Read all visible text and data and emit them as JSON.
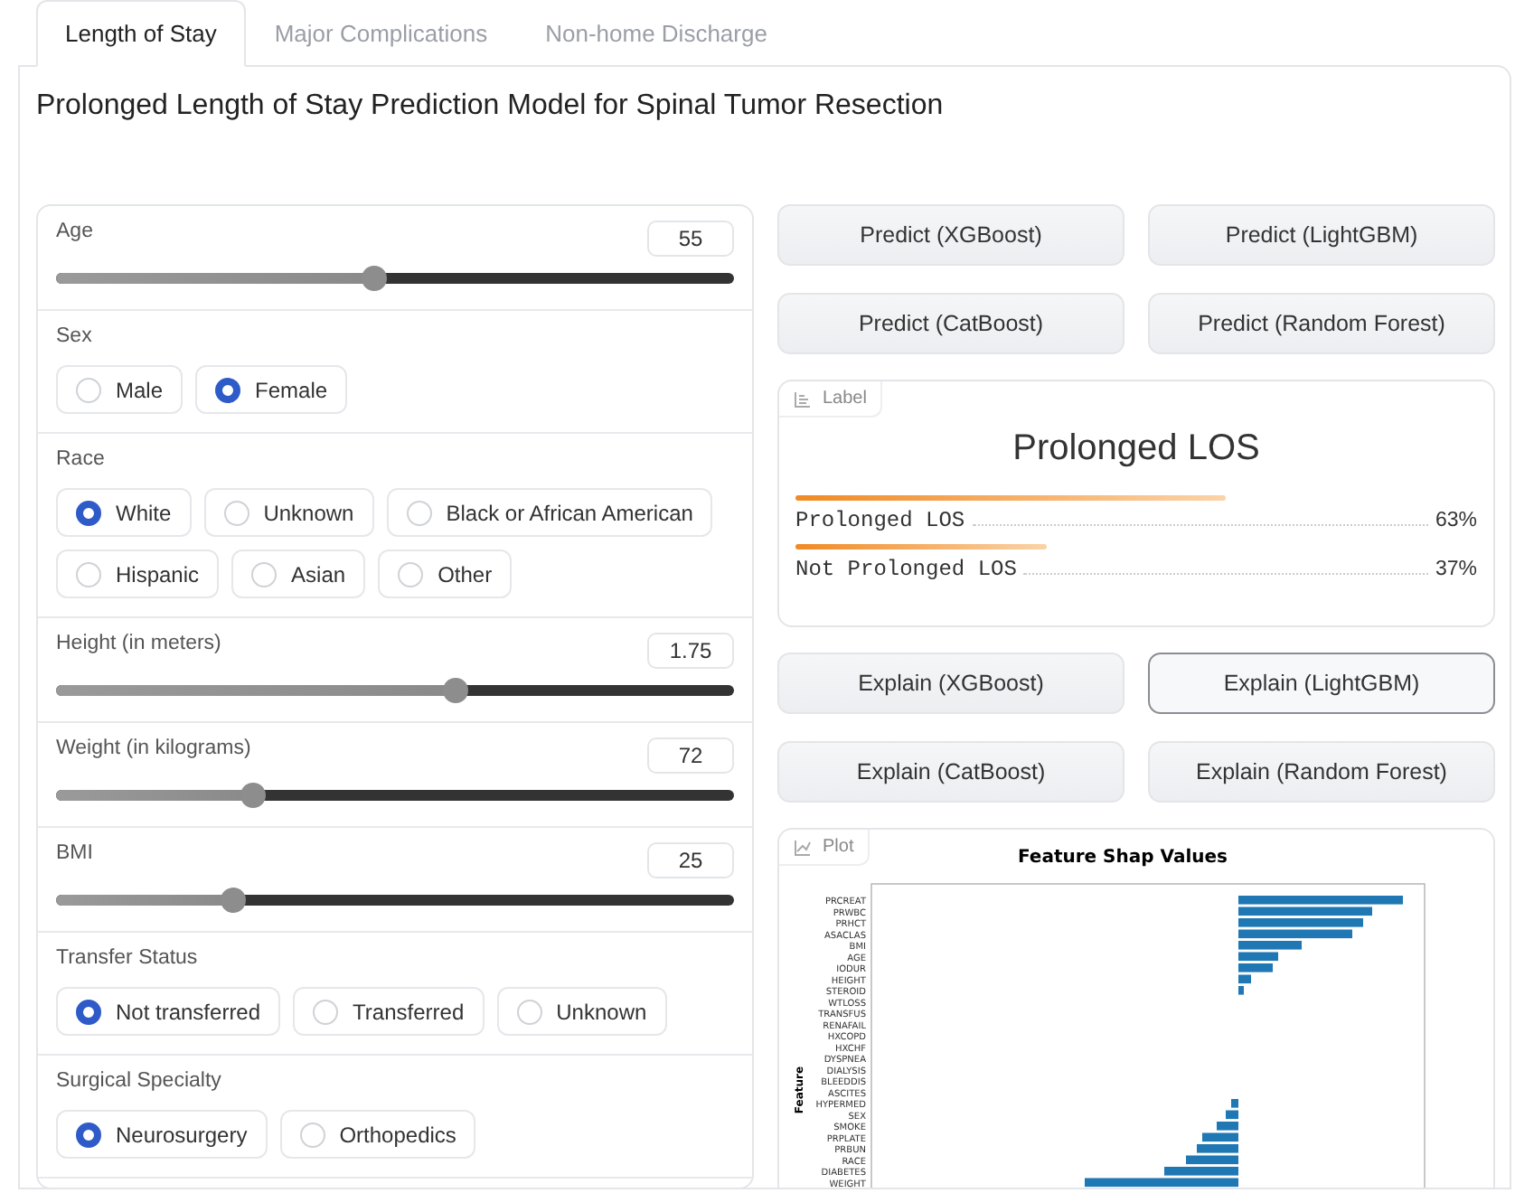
{
  "tabs": [
    {
      "label": "Length of Stay",
      "selected": true
    },
    {
      "label": "Major Complications",
      "selected": false
    },
    {
      "label": "Non-home Discharge",
      "selected": false
    }
  ],
  "title": "Prolonged Length of Stay Prediction Model for Spinal Tumor Resection",
  "inputs": [
    {
      "kind": "slider",
      "label": "Age",
      "value": "55",
      "level": 0.47
    },
    {
      "kind": "radio",
      "label": "Sex",
      "options": [
        {
          "label": "Male",
          "selected": false
        },
        {
          "label": "Female",
          "selected": true
        }
      ]
    },
    {
      "kind": "radio",
      "label": "Race",
      "options": [
        {
          "label": "White",
          "selected": true
        },
        {
          "label": "Unknown",
          "selected": false
        },
        {
          "label": "Black or African American",
          "selected": false
        },
        {
          "label": "Hispanic",
          "selected": false
        },
        {
          "label": "Asian",
          "selected": false
        },
        {
          "label": "Other",
          "selected": false
        }
      ]
    },
    {
      "kind": "slider",
      "label": "Height (in meters)",
      "value": "1.75",
      "level": 0.59
    },
    {
      "kind": "slider",
      "label": "Weight (in kilograms)",
      "value": "72",
      "level": 0.29
    },
    {
      "kind": "slider",
      "label": "BMI",
      "value": "25",
      "level": 0.26
    },
    {
      "kind": "radio",
      "label": "Transfer Status",
      "options": [
        {
          "label": "Not transferred",
          "selected": true
        },
        {
          "label": "Transferred",
          "selected": false
        },
        {
          "label": "Unknown",
          "selected": false
        }
      ]
    },
    {
      "kind": "radio",
      "label": "Surgical Specialty",
      "options": [
        {
          "label": "Neurosurgery",
          "selected": true
        },
        {
          "label": "Orthopedics",
          "selected": false
        }
      ]
    }
  ],
  "predict_buttons": [
    {
      "label": "Predict (XGBoost)",
      "focused": false
    },
    {
      "label": "Predict (LightGBM)",
      "focused": false
    },
    {
      "label": "Predict (CatBoost)",
      "focused": false
    },
    {
      "label": "Predict (Random Forest)",
      "focused": false
    }
  ],
  "label_output": {
    "header": "Label",
    "prediction": "Prolonged LOS",
    "confidences": [
      {
        "label": "Prolonged LOS",
        "percent": "63%"
      },
      {
        "label": "Not Prolonged LOS",
        "percent": "37%"
      }
    ]
  },
  "explain_buttons": [
    {
      "label": "Explain (XGBoost)",
      "focused": false
    },
    {
      "label": "Explain (LightGBM)",
      "focused": true
    },
    {
      "label": "Explain (CatBoost)",
      "focused": false
    },
    {
      "label": "Explain (Random Forest)",
      "focused": false
    }
  ],
  "plot": {
    "header": "Plot",
    "title": "Feature Shap Values",
    "ylabel": "Feature",
    "features": [
      "PRCREAT",
      "PRWBC",
      "PRHCT",
      "ASACLAS",
      "BMI",
      "AGE",
      "IODUR",
      "HEIGHT",
      "STEROID",
      "WTLOSS",
      "TRANSFUS",
      "RENAFAIL",
      "HXCOPD",
      "HXCHF",
      "DYSPNEA",
      "DIALYSIS",
      "BLEEDDIS",
      "ASCITES",
      "HYPERMED",
      "SEX",
      "SMOKE",
      "PRPLATE",
      "PRBUN",
      "RACE",
      "DIABETES",
      "WEIGHT"
    ]
  }
}
